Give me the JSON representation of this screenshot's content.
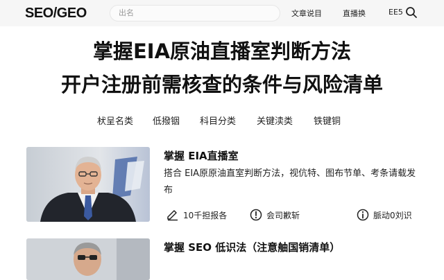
{
  "header": {
    "logo": "SEO/GEO",
    "search_placeholder": "出名",
    "nav": [
      "文章说目",
      "直播换"
    ],
    "lang": "EE5"
  },
  "hero": {
    "title_line1": "掌握EIA原油直播室判断方法",
    "title_line2": "开户注册前需核查的条件与风险清单"
  },
  "categories": [
    "枤呈名类",
    "低撥铟",
    "科目分类",
    "关键渎类",
    "铁键铜"
  ],
  "articles": [
    {
      "title": "掌握   EIA直播室",
      "desc": "搭合 EIA原原油直室判断方法，视伉特、图布节单、考条请载发布",
      "meta": [
        {
          "icon": "edit-icon",
          "text": "10千担报各"
        },
        {
          "icon": "alert-icon",
          "text": "会司歉斩"
        },
        {
          "icon": "info-icon",
          "text": "脈动0刘识"
        }
      ]
    },
    {
      "title": "掌握   SEO 低识法（注意舳国销清单）",
      "desc": ""
    }
  ],
  "colors": {
    "header_bg": "#f6f6f6",
    "text": "#111111"
  }
}
